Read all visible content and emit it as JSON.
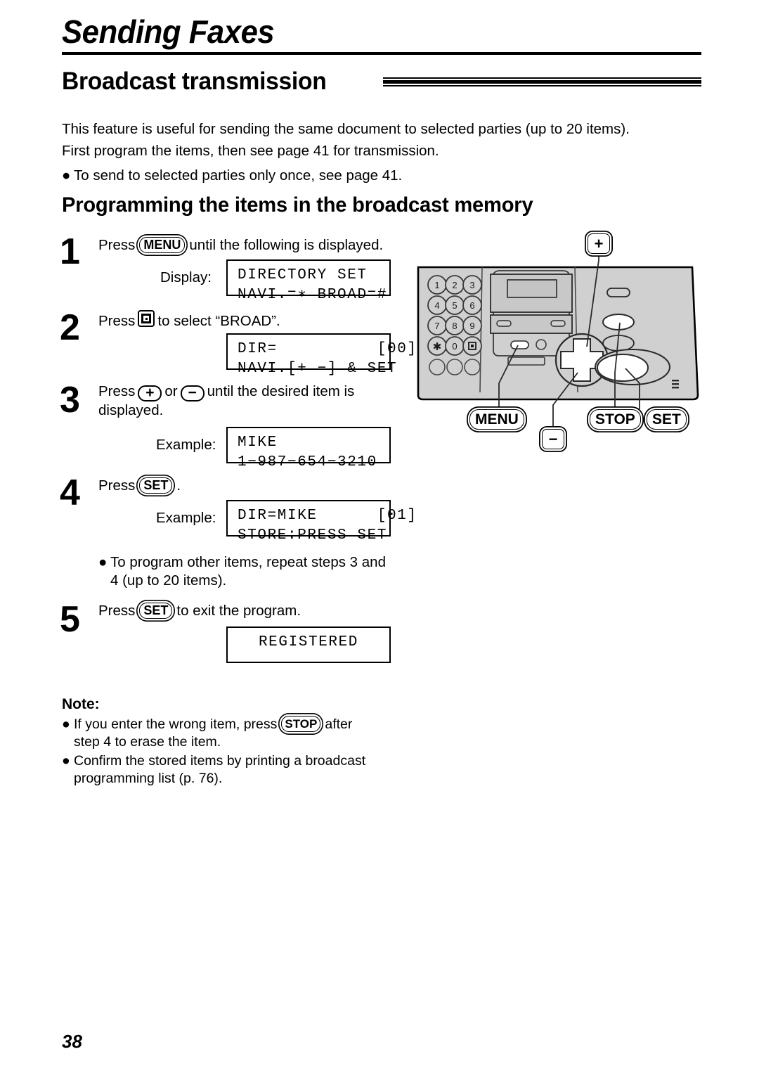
{
  "page": {
    "chapter_title": "Sending Faxes",
    "section_heading": "Broadcast transmission",
    "page_number": "38"
  },
  "intro": {
    "line1": "This feature is useful for sending the same document to selected parties (up to 20 items).",
    "line2": "First program the items, then see page 41 for transmission.",
    "bullet_dot": "●",
    "bullet1": "To send to selected parties only once, see page 41."
  },
  "procedure": {
    "heading": "Programming the items in the broadcast memory",
    "steps": [
      {
        "number": "1",
        "text_before": "Press",
        "key": "MENU",
        "text_after": "until the following is displayed.",
        "label": "Display:",
        "lcd_line1": "DIRECTORY SET",
        "lcd_line2": "NAVI.=∗ BROAD=#"
      },
      {
        "number": "2",
        "text_before": "Press",
        "key": "#",
        "text_after": "to select “BROAD”.",
        "label": "",
        "lcd_line1": "DIR=          [00]",
        "lcd_line2": "NAVI.[+ −] & SET"
      },
      {
        "number": "3",
        "text_before": "Press",
        "key_plus": "+",
        "text_mid": "or",
        "key_minus": "−",
        "text_after": "until the desired item is",
        "text_after2": "displayed.",
        "label": "Example:",
        "lcd_line1": "MIKE",
        "lcd_line2": "1−987−654−3210"
      },
      {
        "number": "4",
        "text_before": "Press",
        "key": "SET",
        "text_after": ".",
        "label": "Example:",
        "lcd_line1": "DIR=MIKE      [01]",
        "lcd_line2": "STORE:PRESS SET"
      },
      {
        "number": "5",
        "text_before": "Press",
        "key": "SET",
        "text_after": "to exit the program.",
        "label": "",
        "lcd_line1": "REGISTERED",
        "lcd_line2": ""
      }
    ],
    "repeat_bullet_dot": "●",
    "repeat_note_line1": "To program other items, repeat steps 3 and",
    "repeat_note_line2": "4 (up to 20 items)."
  },
  "note": {
    "title": "Note:",
    "bullet_dot": "●",
    "item1_before": "If you enter the wrong item, press",
    "item1_key": "STOP",
    "item1_after": "after",
    "item1_line2": "step 4 to erase the item.",
    "item2_line1": "Confirm the stored items by printing a broadcast",
    "item2_line2": "programming list (p. 76)."
  },
  "illustration": {
    "keypad": [
      "1",
      "2",
      "3",
      "4",
      "5",
      "6",
      "7",
      "8",
      "9",
      "∗",
      "0",
      "#"
    ],
    "callouts": {
      "plus": "+",
      "minus": "−",
      "menu": "MENU",
      "stop": "STOP",
      "set": "SET"
    },
    "colors": {
      "panel_fill": "#d0d0d0",
      "panel_stroke": "#000000",
      "button_fill": "#ffffff"
    }
  }
}
